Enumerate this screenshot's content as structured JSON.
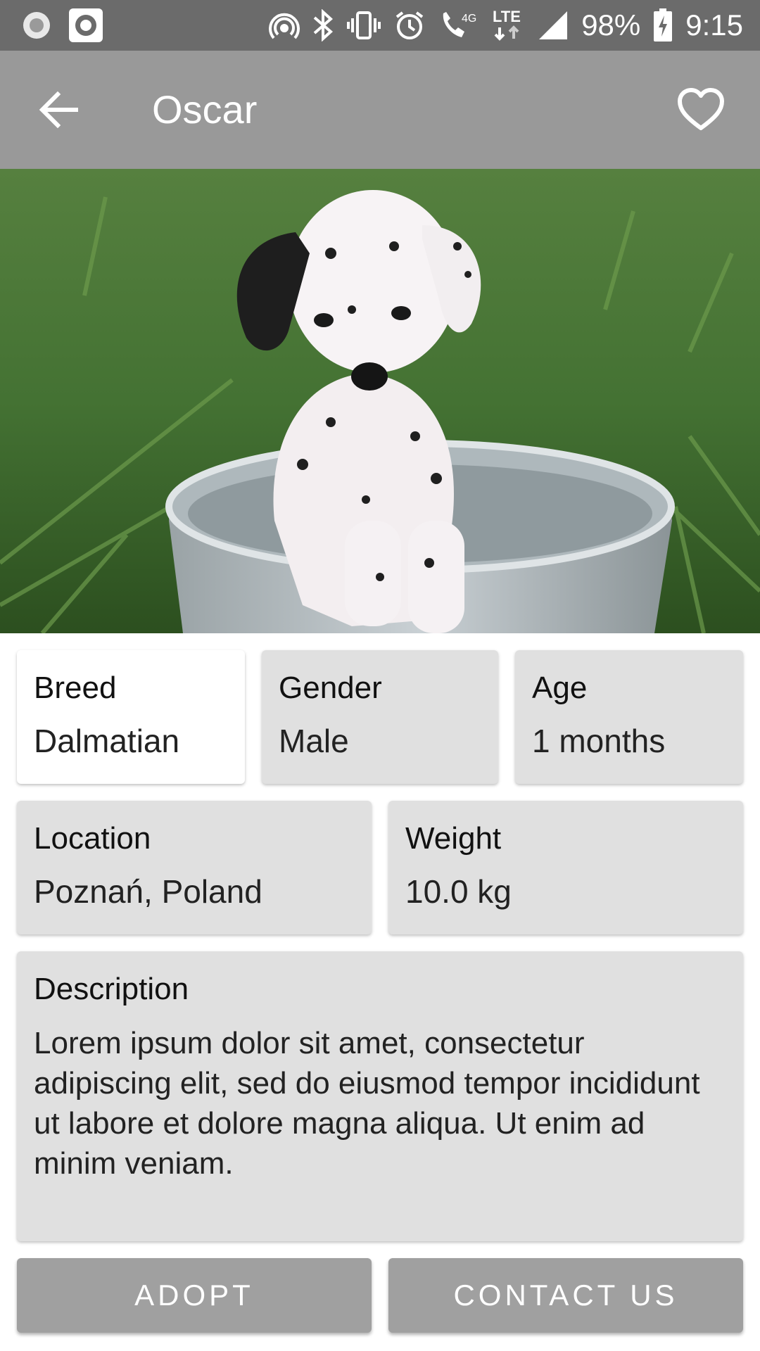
{
  "status_bar": {
    "battery_percent": "98%",
    "time": "9:15",
    "network_label": "4G",
    "lte_label": "LTE",
    "icons": [
      "record-icon",
      "camera-icon",
      "hotspot-icon",
      "bluetooth-icon",
      "vibrate-icon",
      "alarm-icon",
      "wifi-calling-icon",
      "lte-icon",
      "signal-icon",
      "battery-charging-icon"
    ]
  },
  "app_bar": {
    "title": "Oscar",
    "back_icon": "arrow-left-icon",
    "favorite_icon": "heart-outline-icon"
  },
  "hero_image": {
    "subject": "dalmatian-puppy-photo"
  },
  "details": {
    "breed": {
      "label": "Breed",
      "value": "Dalmatian"
    },
    "gender": {
      "label": "Gender",
      "value": "Male"
    },
    "age": {
      "label": "Age",
      "value": "1 months"
    },
    "location": {
      "label": "Location",
      "value": "Poznań, Poland"
    },
    "weight": {
      "label": "Weight",
      "value": "10.0 kg"
    },
    "description": {
      "label": "Description",
      "value": "Lorem ipsum dolor sit amet, consectetur adipiscing elit, sed do eiusmod tempor incididunt ut labore et dolore magna aliqua. Ut enim ad minim veniam."
    }
  },
  "actions": {
    "adopt": "ADOPT",
    "contact": "CONTACT US"
  },
  "colors": {
    "status_bar": "#6b6b6b",
    "app_bar": "#999999",
    "card": "#e0e0e0",
    "button": "#a0a0a0"
  }
}
